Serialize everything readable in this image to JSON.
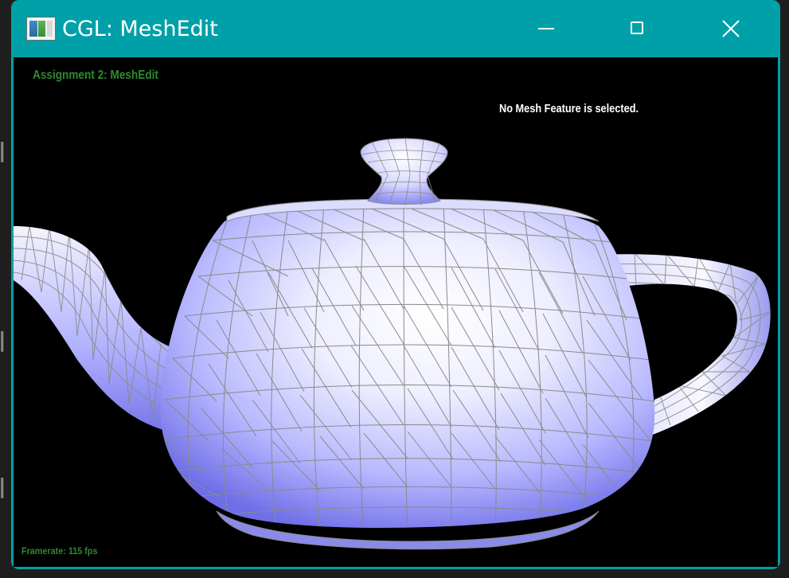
{
  "window": {
    "title": "CGL: MeshEdit",
    "title_bar_color": "#00a0a8",
    "icon": "app-window-icon",
    "controls": {
      "minimize": "minimize-icon",
      "maximize": "maximize-icon",
      "close": "close-icon"
    }
  },
  "viewport": {
    "background": "#000000",
    "hud_title": "Assignment 2: MeshEdit",
    "hud_title_color": "#2f8a2f",
    "status": "No Mesh Feature is selected.",
    "framerate_label": "Framerate:",
    "framerate_value": "115 fps",
    "model": "teapot-mesh",
    "mesh_fill_color": "#a8a8ff",
    "wireframe_color": "#8a8a8a"
  },
  "background_glyphs": [
    "l",
    "l",
    "l"
  ]
}
